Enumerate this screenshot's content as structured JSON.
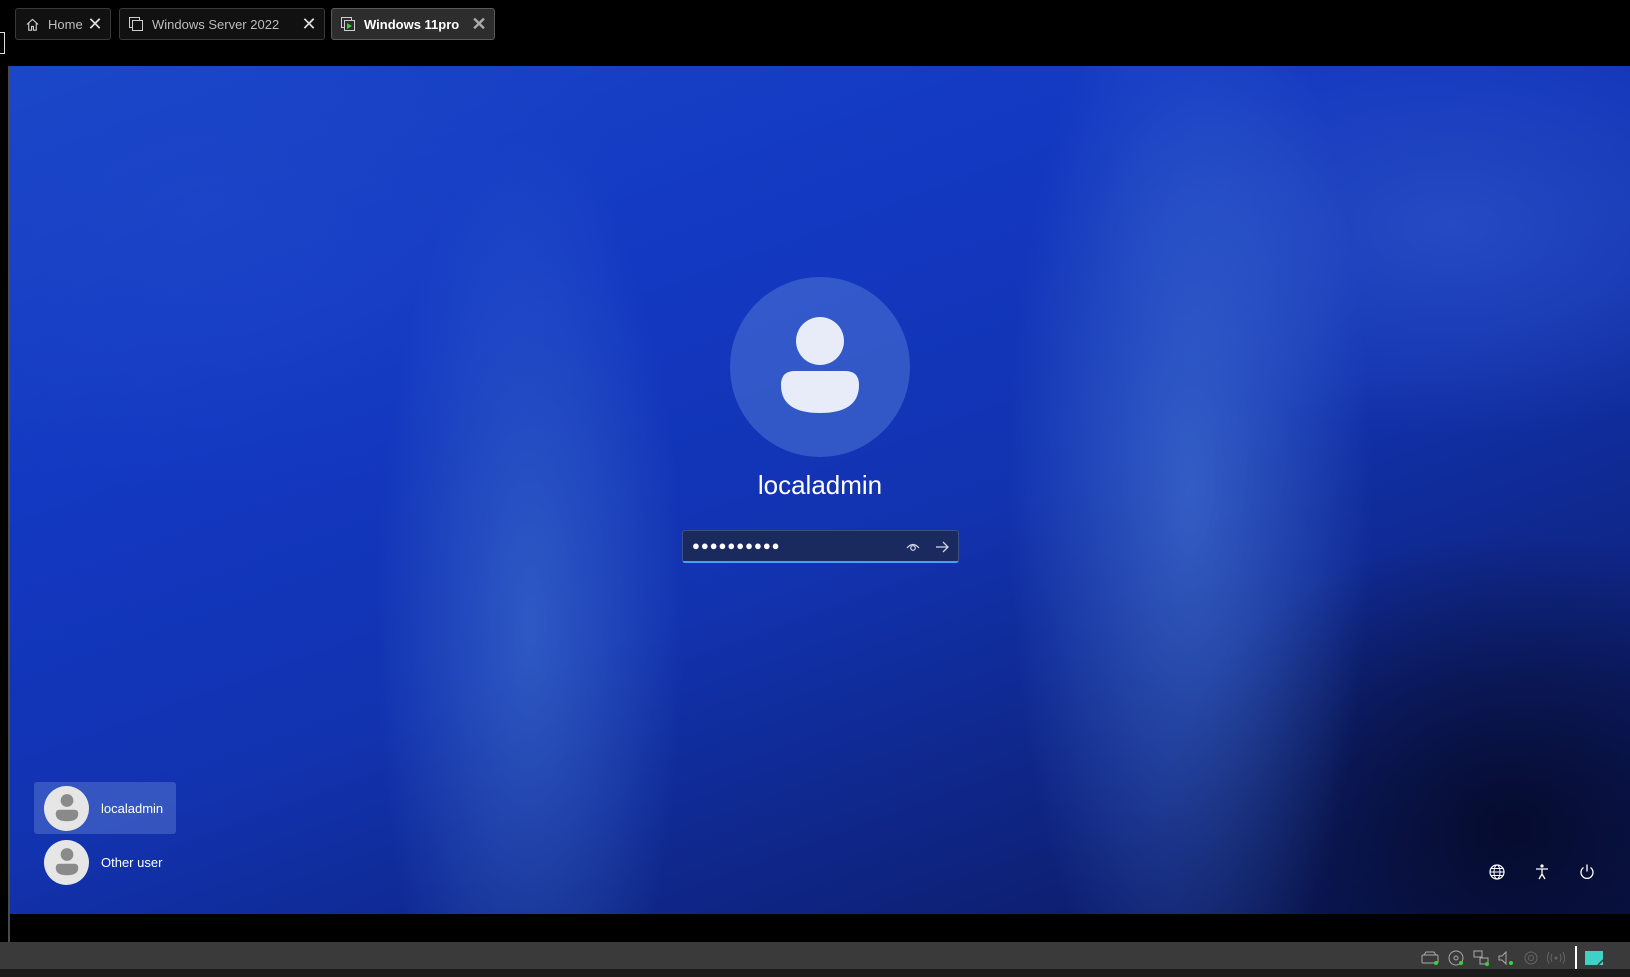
{
  "tabs": [
    {
      "label": "Home",
      "icon": "home-icon"
    },
    {
      "label": "Windows Server 2022",
      "icon": "vm-icon"
    },
    {
      "label": "Windows 11pro",
      "icon": "vm-running-icon",
      "active": true
    }
  ],
  "lockscreen": {
    "username": "localadmin",
    "password_masked": "●●●●●●●●●●",
    "users": [
      {
        "label": "localadmin",
        "selected": true
      },
      {
        "label": "Other user",
        "selected": false
      }
    ],
    "system_icons": [
      "network-icon",
      "accessibility-icon",
      "power-icon"
    ]
  },
  "statusbar": {
    "icons": [
      "hard-disk-icon",
      "cd-dvd-icon",
      "network-adapter-icon",
      "sound-icon",
      "usb-icon",
      "wireless-icon",
      "message-icon"
    ]
  },
  "colors": {
    "accent": "#4a9cff",
    "background": "#1338c2"
  }
}
